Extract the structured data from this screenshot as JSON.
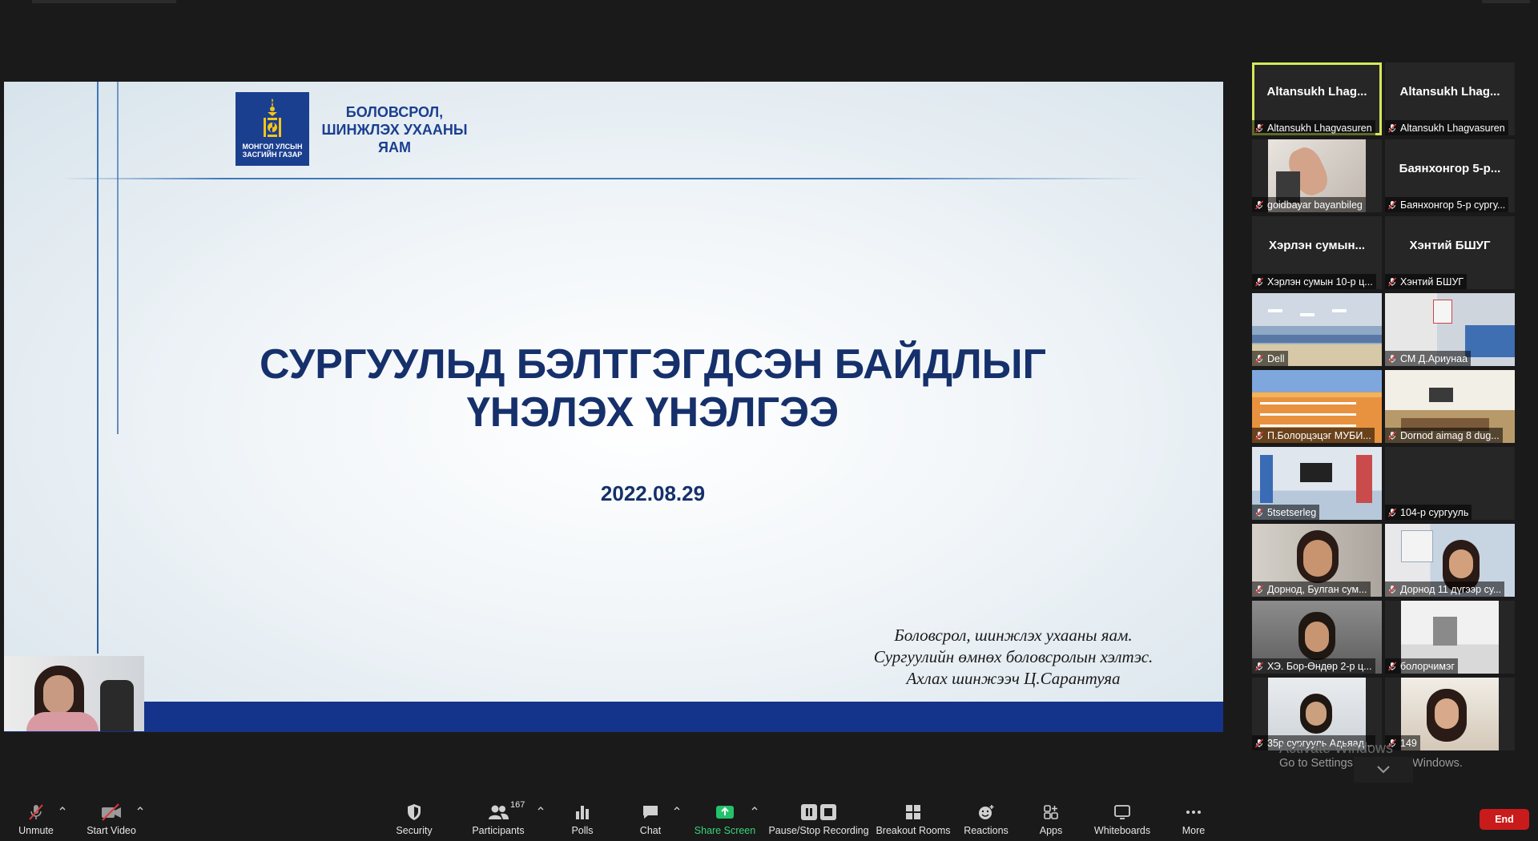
{
  "slide": {
    "logo_caption": "МОНГОЛ УЛСЫН ЗАСГИЙН ГАЗАР",
    "ministry_title": "БОЛОВСРОЛ, ШИНЖЛЭХ УХААНЫ ЯАМ",
    "main_title_line1": "СУРГУУЛЬД БЭЛТГЭГДСЭН БАЙДЛЫГ",
    "main_title_line2": "ҮНЭЛЭХ ҮНЭЛГЭЭ",
    "date": "2022.08.29",
    "signature_line1": "Боловсрол, шинжлэх ухааны яам.",
    "signature_line2": "Сургуулийн өмнөх боловсролын хэлтэс.",
    "signature_line3": "Ахлах шинжээч Ц.Сарантуяа"
  },
  "gallery": {
    "tiles": [
      {
        "big_name": "Altansukh Lhag...",
        "label": "Altansukh Lhagvasuren",
        "active": true
      },
      {
        "big_name": "Altansukh Lhag...",
        "label": "Altansukh Lhagvasuren"
      },
      {
        "label": "goidbayar bayanbileg"
      },
      {
        "big_name": "Баянхонгор 5-р...",
        "label": "Баянхонгор 5-р сургу..."
      },
      {
        "big_name": "Хэрлэн сумын...",
        "label": "Хэрлэн сумын 10-р ц..."
      },
      {
        "big_name": "Хэнтий БШУГ",
        "label": "Хэнтий БШУГ"
      },
      {
        "label": "Dell"
      },
      {
        "label": "СМ Д.Ариунаа"
      },
      {
        "label": "П.Болорцэцэг МУБИ..."
      },
      {
        "label": "Dornod aimag 8 dug..."
      },
      {
        "label": "5tsetserleg"
      },
      {
        "label": "104-р сургууль"
      },
      {
        "label": "Дорнод, Булган сум..."
      },
      {
        "label": "Дорнод 11 дүгээр су..."
      },
      {
        "label": "ХЭ. Бор-Өндөр 2-р ц..."
      },
      {
        "label": "болорчимэг"
      },
      {
        "label": "35р сургууль Адьяад..."
      },
      {
        "label": "149"
      }
    ]
  },
  "watermark": {
    "line1": "Activate Windows",
    "line2": "Go to Settings to activate Windows."
  },
  "toolbar": {
    "unmute": "Unmute",
    "start_video": "Start Video",
    "security": "Security",
    "participants": "Participants",
    "participant_count": "167",
    "polls": "Polls",
    "chat": "Chat",
    "share_screen": "Share Screen",
    "recording": "Pause/Stop Recording",
    "breakout": "Breakout Rooms",
    "reactions": "Reactions",
    "apps": "Apps",
    "whiteboards": "Whiteboards",
    "more": "More",
    "end": "End"
  },
  "colors": {
    "slide_navy": "#15306b",
    "slide_footer": "#14338a",
    "active_speaker": "#d6e85a",
    "share_green": "#38d47a",
    "end_red": "#c91b1b"
  }
}
